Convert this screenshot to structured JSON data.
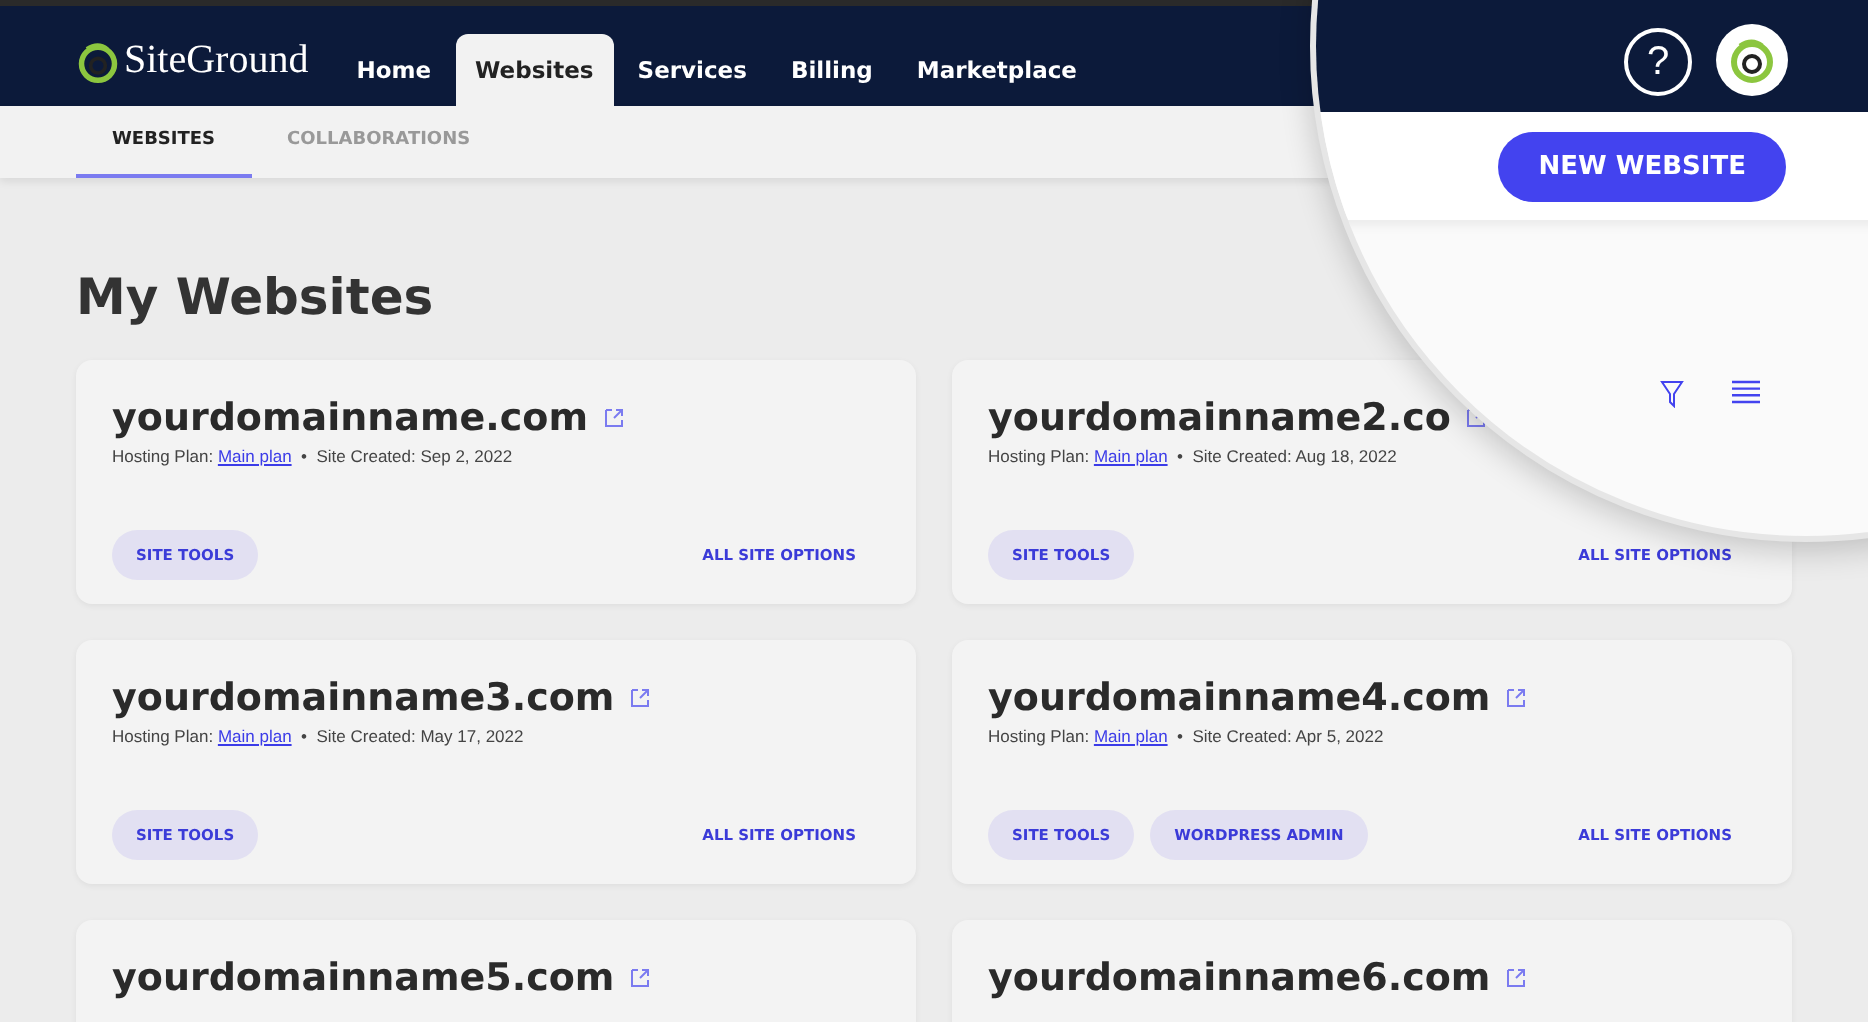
{
  "header": {
    "logo": "SiteGround",
    "nav": [
      {
        "label": "Home",
        "selected": false
      },
      {
        "label": "Websites",
        "selected": true
      },
      {
        "label": "Services",
        "selected": false
      },
      {
        "label": "Billing",
        "selected": false
      },
      {
        "label": "Marketplace",
        "selected": false
      }
    ],
    "help": "?"
  },
  "subtabs": [
    {
      "label": "WEBSITES",
      "selected": true
    },
    {
      "label": "COLLABORATIONS",
      "selected": false
    }
  ],
  "new_website_button": "NEW WEBSITE",
  "page_title": "My Websites",
  "sites": [
    {
      "domain": "yourdomainname.com",
      "plan_label": "Hosting Plan:",
      "plan": "Main plan",
      "created": "Site Created: Sep 2, 2022",
      "buttons": [
        "SITE TOOLS"
      ],
      "options": "ALL SITE OPTIONS"
    },
    {
      "domain": "yourdomainname2.co",
      "plan_label": "Hosting Plan:",
      "plan": "Main plan",
      "created": "Site Created: Aug 18, 2022",
      "buttons": [
        "SITE TOOLS"
      ],
      "options": "ALL SITE OPTIONS"
    },
    {
      "domain": "yourdomainname3.com",
      "plan_label": "Hosting Plan:",
      "plan": "Main plan",
      "created": "Site Created: May 17, 2022",
      "buttons": [
        "SITE TOOLS"
      ],
      "options": "ALL SITE OPTIONS"
    },
    {
      "domain": "yourdomainname4.com",
      "plan_label": "Hosting Plan:",
      "plan": "Main plan",
      "created": "Site Created: Apr 5, 2022",
      "buttons": [
        "SITE TOOLS",
        "WORDPRESS ADMIN"
      ],
      "options": "ALL SITE OPTIONS"
    },
    {
      "domain": "yourdomainname5.com"
    },
    {
      "domain": "yourdomainname6.com"
    }
  ],
  "separator": "•"
}
